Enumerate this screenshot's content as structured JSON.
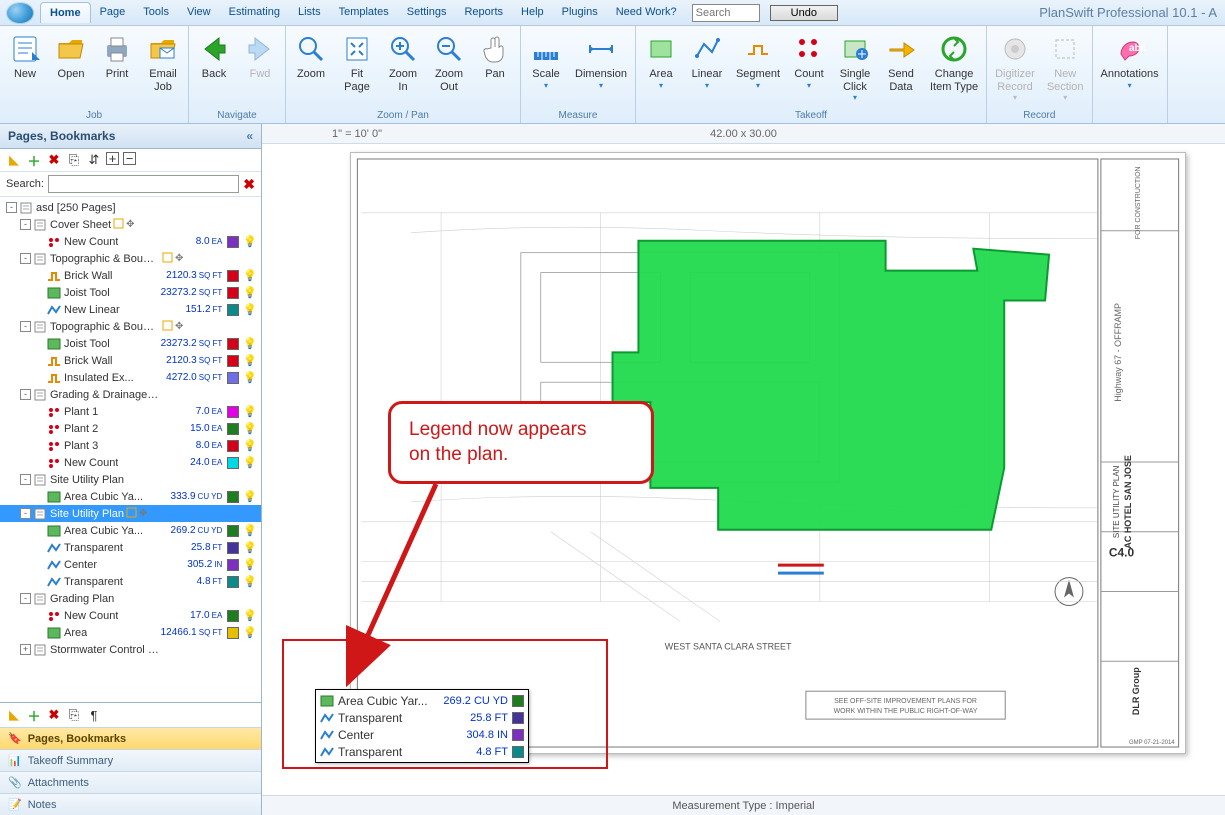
{
  "app": {
    "title": "PlanSwift Professional 10.1 - A"
  },
  "tabs": [
    "Home",
    "Page",
    "Tools",
    "View",
    "Estimating",
    "Lists",
    "Templates",
    "Settings",
    "Reports",
    "Help",
    "Plugins",
    "Need Work?"
  ],
  "tab_active": "Home",
  "search_placeholder": "Search",
  "undo_label": "Undo",
  "ribbon": {
    "job": {
      "label": "Job",
      "buttons": [
        {
          "id": "new",
          "label": "New"
        },
        {
          "id": "open",
          "label": "Open"
        },
        {
          "id": "print",
          "label": "Print"
        },
        {
          "id": "email",
          "label": "Email\nJob"
        }
      ]
    },
    "navigate": {
      "label": "Navigate",
      "buttons": [
        {
          "id": "back",
          "label": "Back"
        },
        {
          "id": "fwd",
          "label": "Fwd",
          "disabled": true
        }
      ]
    },
    "zoompan": {
      "label": "Zoom / Pan",
      "buttons": [
        {
          "id": "zoom",
          "label": "Zoom"
        },
        {
          "id": "fitpage",
          "label": "Fit\nPage"
        },
        {
          "id": "zin",
          "label": "Zoom\nIn"
        },
        {
          "id": "zout",
          "label": "Zoom\nOut"
        },
        {
          "id": "pan",
          "label": "Pan"
        }
      ]
    },
    "measure": {
      "label": "Measure",
      "buttons": [
        {
          "id": "scale",
          "label": "Scale"
        },
        {
          "id": "dimension",
          "label": "Dimension"
        }
      ]
    },
    "takeoff": {
      "label": "Takeoff",
      "buttons": [
        {
          "id": "area",
          "label": "Area"
        },
        {
          "id": "linear",
          "label": "Linear"
        },
        {
          "id": "segment",
          "label": "Segment"
        },
        {
          "id": "count",
          "label": "Count"
        },
        {
          "id": "single",
          "label": "Single\nClick"
        },
        {
          "id": "send",
          "label": "Send\nData"
        },
        {
          "id": "change",
          "label": "Change\nItem Type"
        }
      ]
    },
    "record": {
      "label": "Record",
      "buttons": [
        {
          "id": "digitizer",
          "label": "Digitizer\nRecord",
          "disabled": true
        },
        {
          "id": "newsection",
          "label": "New\nSection",
          "disabled": true
        }
      ]
    },
    "annot": {
      "label": "",
      "buttons": [
        {
          "id": "annotations",
          "label": "Annotations"
        }
      ]
    }
  },
  "side": {
    "title": "Pages, Bookmarks",
    "search_label": "Search:",
    "root": "asd [250 Pages]",
    "bottom_tabs": [
      "Pages, Bookmarks",
      "Takeoff Summary",
      "Attachments",
      "Notes"
    ]
  },
  "tree": [
    {
      "depth": 0,
      "tog": "-",
      "lbl": "asd [250 Pages]"
    },
    {
      "depth": 1,
      "tog": "-",
      "lbl": "Cover Sheet",
      "extras": true
    },
    {
      "depth": 2,
      "ic": "count",
      "lbl": "New Count",
      "val": "8.0",
      "unit": "EA",
      "sw": "#7d2fbf"
    },
    {
      "depth": 1,
      "tog": "-",
      "lbl": "Topographic & Boundary Survey",
      "extras": true
    },
    {
      "depth": 2,
      "ic": "seg",
      "lbl": "Brick Wall",
      "val": "2120.3",
      "unit": "SQ FT",
      "sw": "#d4001a"
    },
    {
      "depth": 2,
      "ic": "area",
      "lbl": "Joist Tool",
      "val": "23273.2",
      "unit": "SQ FT",
      "sw": "#d4001a"
    },
    {
      "depth": 2,
      "ic": "lin",
      "lbl": "New Linear",
      "val": "151.2",
      "unit": "FT",
      "sw": "#0a8a8a"
    },
    {
      "depth": 1,
      "tog": "-",
      "lbl": "Topographic & Boundary Survey",
      "extras": true
    },
    {
      "depth": 2,
      "ic": "area",
      "lbl": "Joist Tool",
      "val": "23273.2",
      "unit": "SQ FT",
      "sw": "#d4001a"
    },
    {
      "depth": 2,
      "ic": "seg",
      "lbl": "Brick Wall",
      "val": "2120.3",
      "unit": "SQ FT",
      "sw": "#d4001a"
    },
    {
      "depth": 2,
      "ic": "seg",
      "lbl": "Insulated Ex...",
      "val": "4272.0",
      "unit": "SQ FT",
      "sw": "#6e6ee6"
    },
    {
      "depth": 1,
      "tog": "-",
      "lbl": "Grading & Drainage Plan"
    },
    {
      "depth": 2,
      "ic": "count",
      "lbl": "Plant 1",
      "val": "7.0",
      "unit": "EA",
      "sw": "#e400e4"
    },
    {
      "depth": 2,
      "ic": "count",
      "lbl": "Plant 2",
      "val": "15.0",
      "unit": "EA",
      "sw": "#1e7d1e"
    },
    {
      "depth": 2,
      "ic": "count",
      "lbl": "Plant 3",
      "val": "8.0",
      "unit": "EA",
      "sw": "#d4001a"
    },
    {
      "depth": 2,
      "ic": "count",
      "lbl": "New Count",
      "val": "24.0",
      "unit": "EA",
      "sw": "#00d8e6"
    },
    {
      "depth": 1,
      "tog": "-",
      "lbl": "Site Utility Plan"
    },
    {
      "depth": 2,
      "ic": "area",
      "lbl": "Area Cubic Ya...",
      "val": "333.9",
      "unit": "CU YD",
      "sw": "#1e7d1e"
    },
    {
      "depth": 1,
      "tog": "-",
      "lbl": "Site Utility Plan",
      "sel": true,
      "extras": true
    },
    {
      "depth": 2,
      "ic": "area",
      "lbl": "Area Cubic Ya...",
      "val": "269.2",
      "unit": "CU YD",
      "sw": "#1e7d1e"
    },
    {
      "depth": 2,
      "ic": "lin",
      "lbl": "Transparent",
      "val": "25.8",
      "unit": "FT",
      "sw": "#43339c"
    },
    {
      "depth": 2,
      "ic": "lin",
      "lbl": "Center",
      "val": "305.2",
      "unit": "IN",
      "sw": "#7d2fbf"
    },
    {
      "depth": 2,
      "ic": "lin",
      "lbl": "Transparent",
      "val": "4.8",
      "unit": "FT",
      "sw": "#0a8a8a"
    },
    {
      "depth": 1,
      "tog": "-",
      "lbl": "Grading Plan"
    },
    {
      "depth": 2,
      "ic": "count",
      "lbl": "New Count",
      "val": "17.0",
      "unit": "EA",
      "sw": "#1e7d1e"
    },
    {
      "depth": 2,
      "ic": "area",
      "lbl": "Area",
      "val": "12466.1",
      "unit": "SQ FT",
      "sw": "#e6c000"
    },
    {
      "depth": 1,
      "tog": "+",
      "lbl": "Stormwater Control Plan"
    }
  ],
  "canvas": {
    "scale_text": "1\" = 10' 0\"",
    "dims_text": "42.00 x 30.00",
    "status": "Measurement Type : Imperial",
    "street": "WEST SANTA CLARA STREET",
    "note1": "SEE OFF-SITE IMPROVEMENT PLANS FOR",
    "note2": "WORK WITHIN THE PUBLIC RIGHT-OF-WAY",
    "rt_offramp": "Highway 67 - OFFRAMP",
    "rt_title": "SITE UTILITY PLAN",
    "rt_sub": "AC HOTEL SAN JOSE",
    "rt_sheet": "C4.0",
    "rt_firm": "DLR Group",
    "rt_date": "GMP 07-21-2014",
    "rt_constr": "FOR CONSTRUCTION"
  },
  "callout": {
    "line1": "Legend now appears",
    "line2": "on the plan."
  },
  "legend": [
    {
      "ic": "area",
      "lbl": "Area Cubic Yar...",
      "val": "269.2 CU YD",
      "sw": "#1e7d1e"
    },
    {
      "ic": "lin",
      "lbl": "Transparent",
      "val": "25.8 FT",
      "sw": "#43339c"
    },
    {
      "ic": "lin",
      "lbl": "Center",
      "val": "304.8 IN",
      "sw": "#7d2fbf"
    },
    {
      "ic": "lin",
      "lbl": "Transparent",
      "val": "4.8 FT",
      "sw": "#0a8a8a"
    }
  ]
}
